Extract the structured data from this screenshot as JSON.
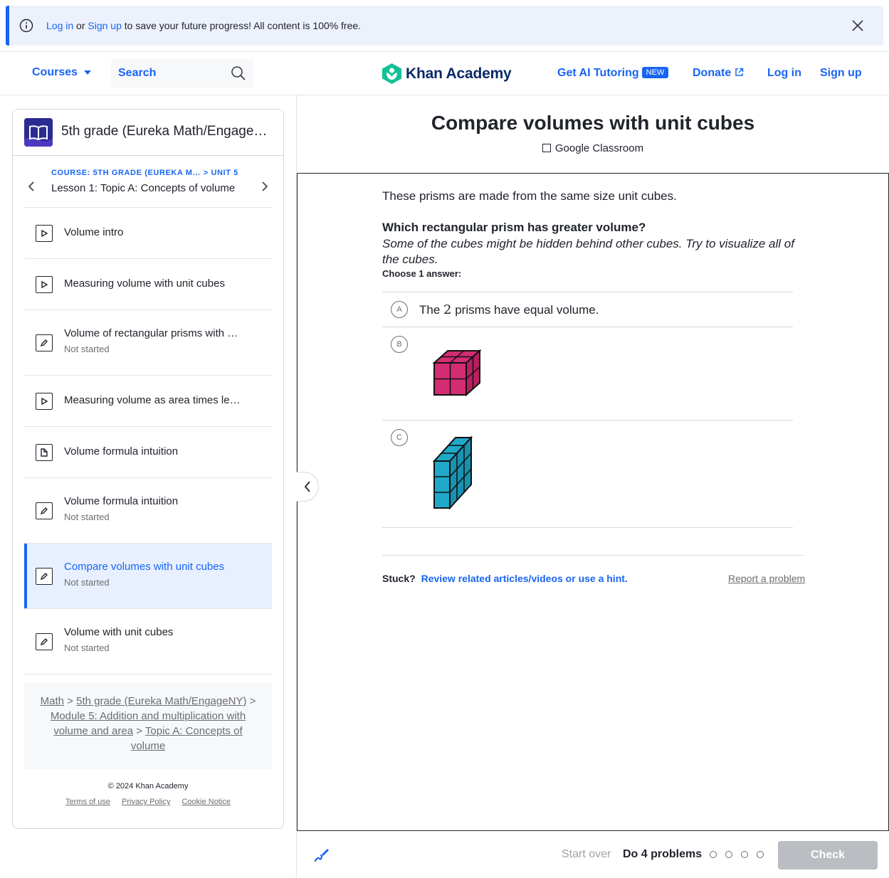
{
  "banner": {
    "login": "Log in",
    "or": "or",
    "signup": "Sign up",
    "rest": "to save your future progress! All content is 100% free."
  },
  "header": {
    "courses": "Courses",
    "search": "Search",
    "brand": "Khan Academy",
    "ai_tutoring": "Get AI Tutoring",
    "new_badge": "NEW",
    "donate": "Donate",
    "login": "Log in",
    "signup": "Sign up"
  },
  "sidebar": {
    "course_title": "5th grade (Eureka Math/Engage…",
    "crumb_course": "COURSE: 5TH GRADE (EUREKA M…",
    "crumb_unit": "> UNIT 5",
    "lesson_title": "Lesson 1: Topic A: Concepts of volume",
    "items": [
      {
        "title": "Volume intro",
        "status": "",
        "icon": "play-icon"
      },
      {
        "title": "Measuring volume with unit cubes",
        "status": "",
        "icon": "play-icon"
      },
      {
        "title": "Volume of rectangular prisms with …",
        "status": "Not started",
        "icon": "pencil-icon"
      },
      {
        "title": "Measuring volume as area times le…",
        "status": "",
        "icon": "play-icon"
      },
      {
        "title": "Volume formula intuition",
        "status": "",
        "icon": "article-icon"
      },
      {
        "title": "Volume formula intuition",
        "status": "Not started",
        "icon": "pencil-icon"
      },
      {
        "title": "Compare volumes with unit cubes",
        "status": "Not started",
        "icon": "pencil-icon",
        "active": true
      },
      {
        "title": "Volume with unit cubes",
        "status": "Not started",
        "icon": "pencil-icon"
      }
    ],
    "breadcrumbs": [
      "Math",
      "5th grade (Eureka Math/EngageNY)",
      "Module 5: Addition and multiplication with volume and area",
      "Topic A: Concepts of volume"
    ],
    "copyright": "© 2024 Khan Academy",
    "footer_links": [
      "Terms of use",
      "Privacy Policy",
      "Cookie Notice"
    ]
  },
  "exercise": {
    "title": "Compare volumes with unit cubes",
    "google_classroom": "Google Classroom",
    "intro": "These prisms are made from the same size unit cubes.",
    "question": "Which rectangular prism has greater volume?",
    "hint": "Some of the cubes might be hidden behind other cubes. Try to visualize all of the cubes.",
    "choose": "Choose 1 answer:",
    "choices": [
      {
        "letter": "A",
        "text_before": "The",
        "number": "2",
        "text_after": "prisms have equal volume."
      },
      {
        "letter": "B",
        "image": "magenta-cube-prism"
      },
      {
        "letter": "C",
        "image": "teal-tall-prism"
      }
    ],
    "stuck": "Stuck?",
    "stuck_link": "Review related articles/videos or use a hint.",
    "report": "Report a problem"
  },
  "bottom": {
    "start_over": "Start over",
    "do_problems": "Do 4 problems",
    "check": "Check",
    "progress_dots": 4
  },
  "colors": {
    "accent": "#1865f2",
    "magenta": "#d42c72",
    "teal": "#1fa9c9",
    "logo_green": "#14bf96"
  }
}
